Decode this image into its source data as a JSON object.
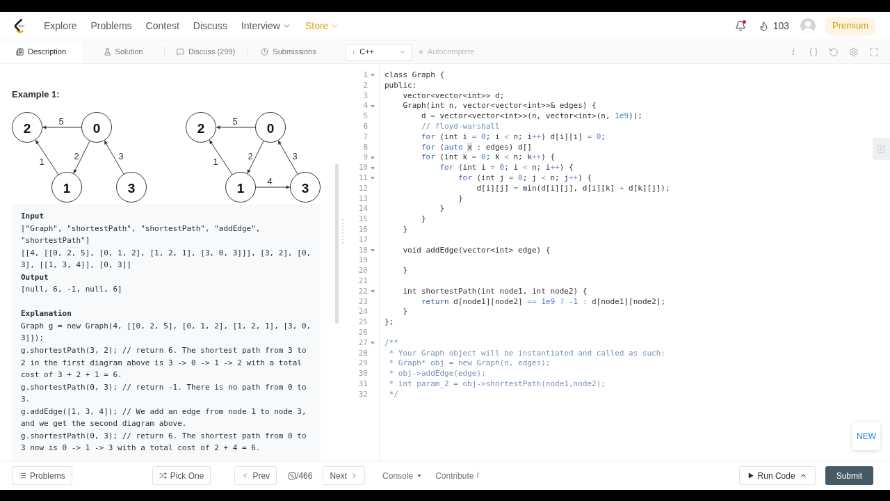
{
  "nav": {
    "items": [
      {
        "label": "Explore",
        "dropdown": false,
        "highlighted": false
      },
      {
        "label": "Problems",
        "dropdown": false,
        "highlighted": false
      },
      {
        "label": "Contest",
        "dropdown": false,
        "highlighted": false
      },
      {
        "label": "Discuss",
        "dropdown": false,
        "highlighted": false
      },
      {
        "label": "Interview",
        "dropdown": true,
        "highlighted": false
      },
      {
        "label": "Store",
        "dropdown": true,
        "highlighted": true
      }
    ],
    "unread": true,
    "streak": "103",
    "premium": "Premium"
  },
  "description_tabs": [
    {
      "label": "Description",
      "selected": true
    },
    {
      "label": "Solution",
      "selected": false
    },
    {
      "label": "Discuss (299)",
      "selected": false
    },
    {
      "label": "Submissions",
      "selected": false
    }
  ],
  "editor_toolbar": {
    "language_glyph": "i",
    "language": "C++",
    "autocomplete": {
      "label": "Autocomplete",
      "on": false
    },
    "info_glyph": "i"
  },
  "problem": {
    "heading": "Example 1:",
    "diagrams": [
      {
        "nodes": [
          "2",
          "0",
          "1",
          "3"
        ],
        "edges": [
          "5",
          "2",
          "1",
          "3"
        ]
      },
      {
        "nodes": [
          "2",
          "0",
          "1",
          "3"
        ],
        "edges": [
          "5",
          "2",
          "1",
          "3",
          "4"
        ]
      }
    ],
    "example_lines": [
      {
        "kind": "label",
        "text": "Input"
      },
      {
        "kind": "text",
        "text": "[\"Graph\", \"shortestPath\", \"shortestPath\", \"addEdge\", \"shortestPath\"]"
      },
      {
        "kind": "text",
        "text": "[[4, [[0, 2, 5], [0, 1, 2], [1, 2, 1], [3, 0, 3]]], [3, 2], [0, 3], [[1, 3, 4]], [0, 3]]"
      },
      {
        "kind": "label",
        "text": "Output"
      },
      {
        "kind": "text",
        "text": "[null, 6, -1, null, 6]"
      },
      {
        "kind": "section_label",
        "text": "Explanation"
      },
      {
        "kind": "text",
        "text": "Graph g = new Graph(4, [[0, 2, 5], [0, 1, 2], [1, 2, 1], [3, 0, 3]]);"
      },
      {
        "kind": "text",
        "text": "g.shortestPath(3, 2); // return 6. The shortest path from 3 to 2 in the first diagram above is 3 -> 0 -> 1 -> 2 with a total cost of 3 + 2 + 1 = 6."
      },
      {
        "kind": "text",
        "text": "g.shortestPath(0, 3); // return -1. There is no path from 0 to 3."
      },
      {
        "kind": "text",
        "text": "g.addEdge([1, 3, 4]); // We add an edge from node 1 to node 3, and we get the second diagram above."
      },
      {
        "kind": "text",
        "text": "g.shortestPath(0, 3); // return 6. The shortest path from 0 to 3 now is 0 -> 1 -> 3 with a total cost of 2 + 4 = 6."
      }
    ]
  },
  "editor": {
    "lines": [
      {
        "number": "1",
        "foldable": true,
        "tokens": [
          {
            "text": "class Graph {",
            "kind": "text"
          }
        ]
      },
      {
        "number": "2",
        "foldable": false,
        "tokens": [
          {
            "text": "public:",
            "kind": "text"
          }
        ]
      },
      {
        "number": "3",
        "foldable": false,
        "tokens": [
          {
            "text": "    vector<vector<int>> d;",
            "kind": "text"
          }
        ]
      },
      {
        "number": "4",
        "foldable": true,
        "tokens": [
          {
            "text": "    Graph(int n, vector<vector<int>>& edges) {",
            "kind": "text"
          }
        ]
      },
      {
        "number": "5",
        "foldable": false,
        "tokens": [
          {
            "text": "        d ",
            "kind": "text"
          },
          {
            "text": "=",
            "kind": "operator"
          },
          {
            "text": " vector<vector<int>>(n, vector<int>(n, ",
            "kind": "text"
          },
          {
            "text": "1e9",
            "kind": "number"
          },
          {
            "text": "));",
            "kind": "text"
          }
        ]
      },
      {
        "number": "6",
        "foldable": false,
        "tokens": [
          {
            "text": "        // floyd-warshall",
            "kind": "comment"
          }
        ]
      },
      {
        "number": "7",
        "foldable": false,
        "tokens": [
          {
            "text": "        for",
            "kind": "keyword"
          },
          {
            "text": " (int i ",
            "kind": "text"
          },
          {
            "text": "=",
            "kind": "operator"
          },
          {
            "text": " 0",
            "kind": "number"
          },
          {
            "text": "; i ",
            "kind": "text"
          },
          {
            "text": "<",
            "kind": "operator"
          },
          {
            "text": " n; i",
            "kind": "text"
          },
          {
            "text": "++",
            "kind": "operator"
          },
          {
            "text": ") d[i][i] ",
            "kind": "text"
          },
          {
            "text": "=",
            "kind": "operator"
          },
          {
            "text": " 0",
            "kind": "number"
          },
          {
            "text": ";",
            "kind": "text"
          }
        ]
      },
      {
        "number": "8",
        "foldable": false,
        "tokens": [
          {
            "text": "        for",
            "kind": "keyword"
          },
          {
            "text": " (",
            "kind": "text"
          },
          {
            "text": "auto ",
            "kind": "keyword"
          },
          {
            "text": "x",
            "kind": "highlight"
          },
          {
            "text": " : edges) d[]",
            "kind": "text"
          }
        ]
      },
      {
        "number": "9",
        "foldable": true,
        "tokens": [
          {
            "text": "        for",
            "kind": "keyword"
          },
          {
            "text": " (int k ",
            "kind": "text"
          },
          {
            "text": "=",
            "kind": "operator"
          },
          {
            "text": " 0",
            "kind": "number"
          },
          {
            "text": "; k ",
            "kind": "text"
          },
          {
            "text": "<",
            "kind": "operator"
          },
          {
            "text": " n; k",
            "kind": "text"
          },
          {
            "text": "++",
            "kind": "operator"
          },
          {
            "text": ") {",
            "kind": "text"
          }
        ]
      },
      {
        "number": "10",
        "foldable": true,
        "tokens": [
          {
            "text": "            for",
            "kind": "keyword"
          },
          {
            "text": " (int i ",
            "kind": "text"
          },
          {
            "text": "=",
            "kind": "operator"
          },
          {
            "text": " 0",
            "kind": "number"
          },
          {
            "text": "; i ",
            "kind": "text"
          },
          {
            "text": "<",
            "kind": "operator"
          },
          {
            "text": " n; i",
            "kind": "text"
          },
          {
            "text": "++",
            "kind": "operator"
          },
          {
            "text": ") {",
            "kind": "text"
          }
        ]
      },
      {
        "number": "11",
        "foldable": true,
        "tokens": [
          {
            "text": "                for",
            "kind": "keyword"
          },
          {
            "text": " (int j ",
            "kind": "text"
          },
          {
            "text": "=",
            "kind": "operator"
          },
          {
            "text": " 0",
            "kind": "number"
          },
          {
            "text": "; j ",
            "kind": "text"
          },
          {
            "text": "<",
            "kind": "operator"
          },
          {
            "text": " n; j",
            "kind": "text"
          },
          {
            "text": "++",
            "kind": "operator"
          },
          {
            "text": ") {",
            "kind": "text"
          }
        ]
      },
      {
        "number": "12",
        "foldable": false,
        "tokens": [
          {
            "text": "                    d[i][j] ",
            "kind": "text"
          },
          {
            "text": "=",
            "kind": "operator"
          },
          {
            "text": " min(d[i][j], d[i][k] ",
            "kind": "text"
          },
          {
            "text": "+",
            "kind": "operator"
          },
          {
            "text": " d[k][j]);",
            "kind": "text"
          }
        ]
      },
      {
        "number": "13",
        "foldable": false,
        "tokens": [
          {
            "text": "                }",
            "kind": "text"
          }
        ]
      },
      {
        "number": "14",
        "foldable": false,
        "tokens": [
          {
            "text": "            }",
            "kind": "text"
          }
        ]
      },
      {
        "number": "15",
        "foldable": false,
        "tokens": [
          {
            "text": "        }",
            "kind": "text"
          }
        ]
      },
      {
        "number": "16",
        "foldable": false,
        "tokens": [
          {
            "text": "    }",
            "kind": "text"
          }
        ]
      },
      {
        "number": "17",
        "foldable": false
      },
      {
        "number": "18",
        "foldable": true,
        "tokens": [
          {
            "text": "    void addEdge(vector<int> edge) {",
            "kind": "text"
          }
        ]
      },
      {
        "number": "19",
        "foldable": false
      },
      {
        "number": "20",
        "foldable": false,
        "tokens": [
          {
            "text": "    }",
            "kind": "text"
          }
        ]
      },
      {
        "number": "21",
        "foldable": false
      },
      {
        "number": "22",
        "foldable": true,
        "tokens": [
          {
            "text": "    int shortestPath(int node1, int node2) {",
            "kind": "text"
          }
        ]
      },
      {
        "number": "23",
        "foldable": false,
        "tokens": [
          {
            "text": "        return",
            "kind": "keyword"
          },
          {
            "text": " d[node1][node2] ",
            "kind": "text"
          },
          {
            "text": "==",
            "kind": "operator"
          },
          {
            "text": " 1e9 ",
            "kind": "number"
          },
          {
            "text": "?",
            "kind": "operator"
          },
          {
            "text": " -1 ",
            "kind": "number"
          },
          {
            "text": ":",
            "kind": "operator"
          },
          {
            "text": " d[node1][node2];",
            "kind": "text"
          }
        ]
      },
      {
        "number": "24",
        "foldable": false,
        "tokens": [
          {
            "text": "    }",
            "kind": "text"
          }
        ]
      },
      {
        "number": "25",
        "foldable": false,
        "tokens": [
          {
            "text": "};",
            "kind": "text"
          }
        ]
      },
      {
        "number": "26",
        "foldable": false
      },
      {
        "number": "27",
        "foldable": true,
        "tokens": [
          {
            "text": "/**",
            "kind": "comment"
          }
        ]
      },
      {
        "number": "28",
        "foldable": false,
        "tokens": [
          {
            "text": " * Your Graph object will be instantiated and called as such:",
            "kind": "comment"
          }
        ]
      },
      {
        "number": "29",
        "foldable": false,
        "tokens": [
          {
            "text": " * Graph* obj = new Graph(n, edges);",
            "kind": "comment"
          }
        ]
      },
      {
        "number": "30",
        "foldable": false,
        "tokens": [
          {
            "text": " * obj->addEdge(edge);",
            "kind": "comment"
          }
        ]
      },
      {
        "number": "31",
        "foldable": false,
        "tokens": [
          {
            "text": " * int param_2 = obj->shortestPath(node1,node2);",
            "kind": "comment"
          }
        ]
      },
      {
        "number": "32",
        "foldable": false,
        "tokens": [
          {
            "text": " */",
            "kind": "comment"
          }
        ]
      }
    ]
  },
  "new_badge": "NEW",
  "bottom_bar": {
    "problems": "Problems",
    "pick_one": "Pick One",
    "prev": "Prev",
    "counter": "/466",
    "next": "Next",
    "console": "Console",
    "contribute": {
      "label": "Contribute",
      "glyph": "i"
    },
    "run_code": "Run Code",
    "submit": "Submit"
  }
}
